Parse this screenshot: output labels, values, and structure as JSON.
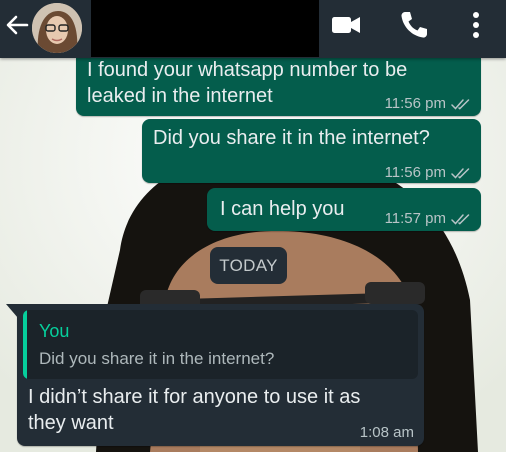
{
  "header": {
    "back_icon": "arrow-left-icon",
    "avatar_icon": "contact-photo",
    "video_icon": "video-camera-icon",
    "call_icon": "phone-icon",
    "menu_icon": "more-vertical-icon",
    "bar_color": "#232d36"
  },
  "messages": [
    {
      "direction": "outgoing",
      "text": "I found your whatsapp number to be\nleaked in the internet",
      "time": "11:56 pm",
      "status": "read"
    },
    {
      "direction": "outgoing",
      "text": "Did you share it in the internet?",
      "time": "11:56 pm",
      "status": "read"
    },
    {
      "direction": "outgoing",
      "text": "I can help you",
      "time": "11:57 pm",
      "status": "read"
    }
  ],
  "date_divider": "TODAY",
  "reply_message": {
    "direction": "incoming",
    "quoted_author": "You",
    "quoted_text": "Did you share it in the internet?",
    "text": "I didn’t share it for anyone to use it as\nthey want",
    "time": "1:08 am"
  },
  "colors": {
    "outgoing_bubble": "#045d4c",
    "incoming_bubble": "#232d36",
    "accent": "#06cf9c"
  }
}
